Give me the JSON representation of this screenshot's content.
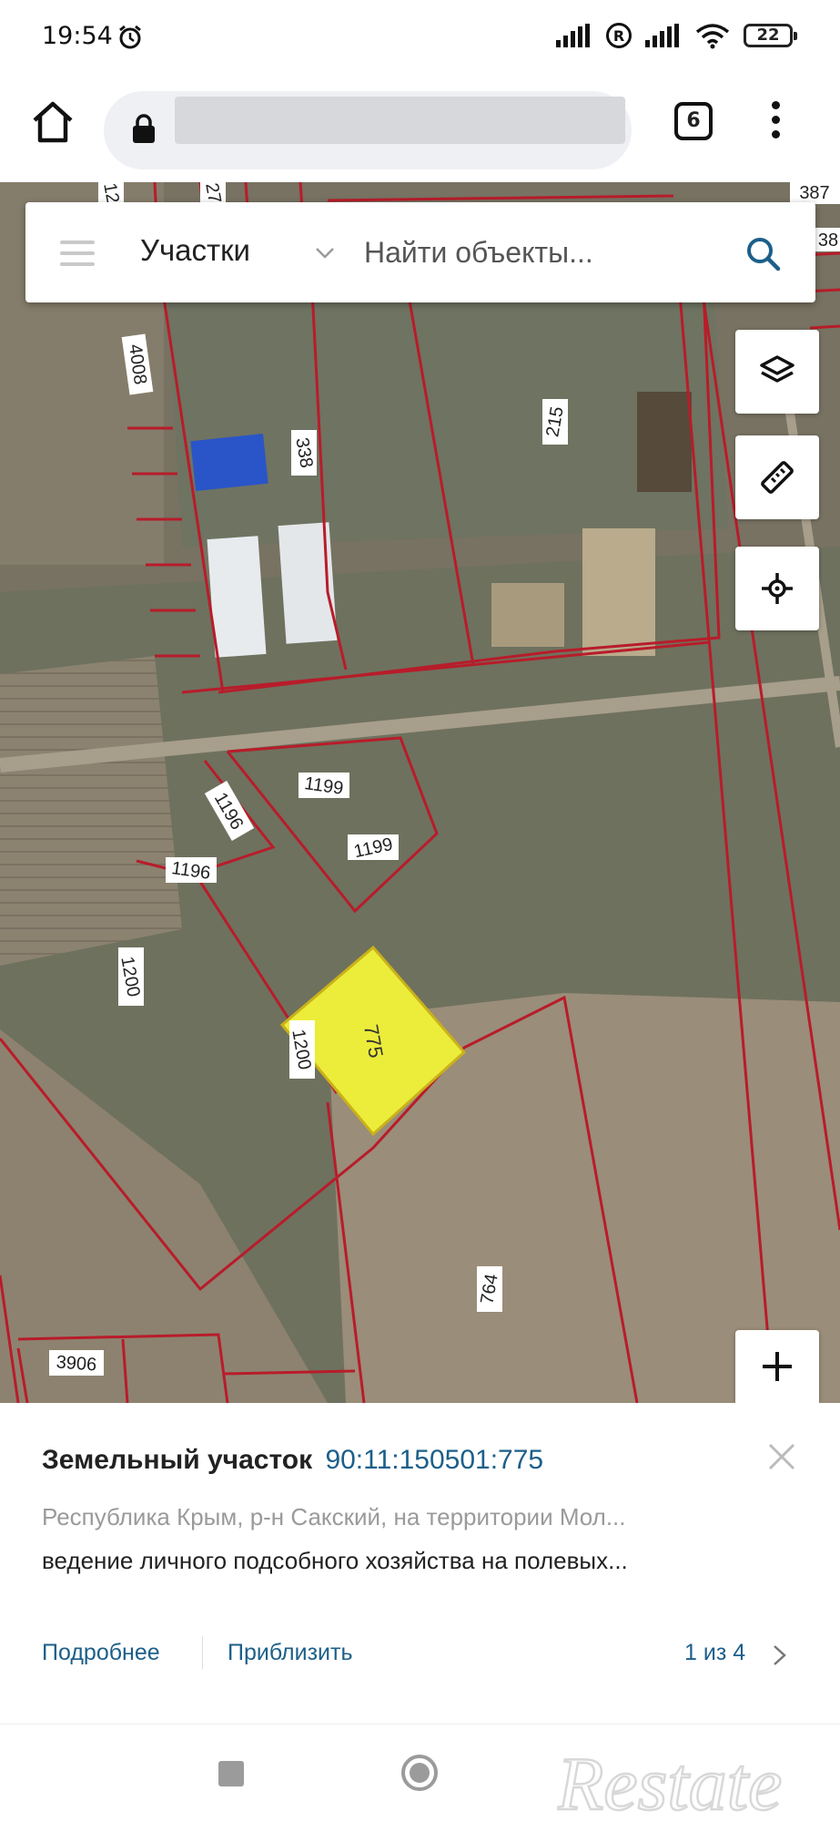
{
  "status_bar": {
    "time": "19:54",
    "battery": "22"
  },
  "browser": {
    "tab_count": "6"
  },
  "search": {
    "layer": "Участки",
    "placeholder": "Найти объекты..."
  },
  "map": {
    "parcel_labels": [
      "4008",
      "338",
      "215",
      "1199",
      "1199",
      "1196",
      "1196",
      "775",
      "1200",
      "1200",
      "764",
      "3906"
    ],
    "edge_labels": [
      "387",
      "38",
      "12",
      "27"
    ],
    "highlight_color": "#ecec3a",
    "boundary_color": "#b81c2a"
  },
  "info": {
    "type": "Земельный участок",
    "cadastral_number": "90:11:150501:775",
    "address": "Республика Крым, р-н Сакский, на территории Мол...",
    "usage": "ведение личного подсобного хозяйства на полевых...",
    "more_label": "Подробнее",
    "zoom_label": "Приблизить",
    "pager": "1 из 4"
  },
  "watermark": {
    "text": "Restate"
  }
}
